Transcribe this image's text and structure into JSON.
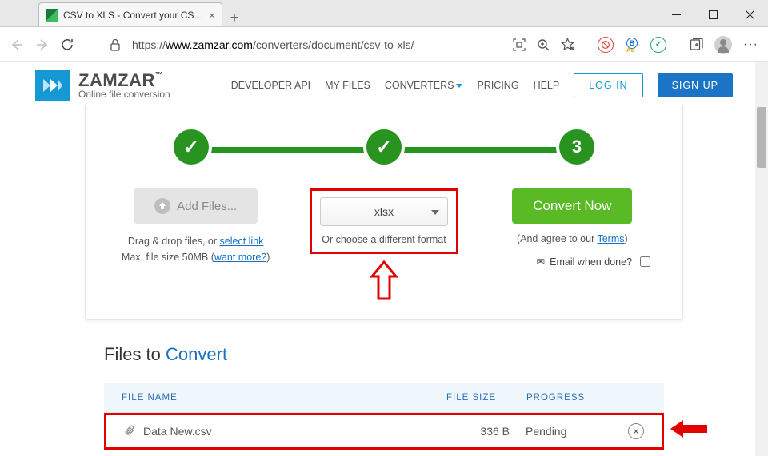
{
  "browser": {
    "tab_title": "CSV to XLS - Convert your CSV to",
    "url_prefix": "https://",
    "url_host": "www.zamzar.com",
    "url_path": "/converters/document/csv-to-xls/"
  },
  "header": {
    "brand": "ZAMZAR",
    "tagline": "Online file conversion",
    "nav": {
      "developer": "DEVELOPER API",
      "myfiles": "MY FILES",
      "converters": "CONVERTERS",
      "pricing": "PRICING",
      "help": "HELP"
    },
    "login": "LOG IN",
    "signup": "SIGN UP"
  },
  "steps": {
    "step3": "3",
    "add_files": "Add Files...",
    "drag_prefix": "Drag & drop files, or ",
    "drag_link": "select link",
    "max_prefix": "Max. file size 50MB (",
    "max_link": "want more?",
    "max_suffix": ")",
    "format_selected": "xlsx",
    "or_choose": "Or choose a different format",
    "convert": "Convert Now",
    "agree_prefix": "(And agree to our ",
    "agree_link": "Terms",
    "agree_suffix": ")",
    "email_label": "Email when done?"
  },
  "files_section": {
    "title_prefix": "Files to ",
    "title_hl": "Convert",
    "col_name": "FILE NAME",
    "col_size": "FILE SIZE",
    "col_progress": "PROGRESS",
    "rows": [
      {
        "name": "Data New.csv",
        "size": "336 B",
        "progress": "Pending"
      }
    ]
  }
}
